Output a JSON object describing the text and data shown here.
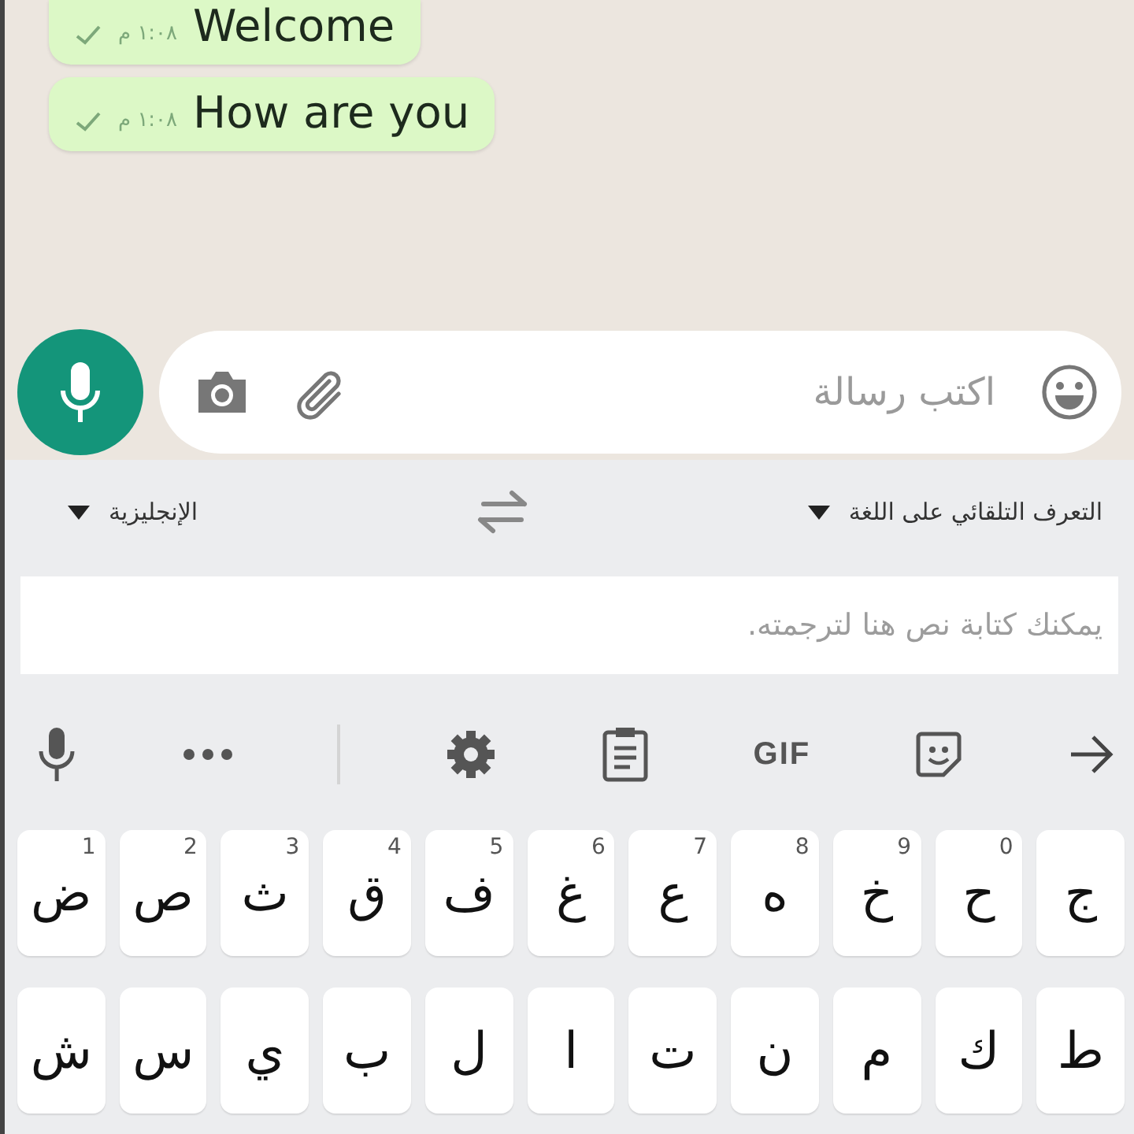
{
  "messages": [
    {
      "text": "Welcome",
      "time": "١:٠٨ م",
      "delivered": true
    },
    {
      "text": "How are you",
      "time": "١:٠٨ م",
      "delivered": true
    }
  ],
  "composer": {
    "placeholder": "اكتب رسالة"
  },
  "translator": {
    "source_language": "التعرف التلقائي على اللغة",
    "target_language": "الإنجليزية",
    "placeholder": "يمكنك كتابة نص هنا لترجمته."
  },
  "toolbar": {
    "gif_label": "GIF"
  },
  "keyboard": {
    "rows": [
      [
        {
          "char": "ج"
        },
        {
          "char": "ح",
          "hint": "0"
        },
        {
          "char": "خ",
          "hint": "9"
        },
        {
          "char": "ه",
          "hint": "8"
        },
        {
          "char": "ع",
          "hint": "7"
        },
        {
          "char": "غ",
          "hint": "6"
        },
        {
          "char": "ف",
          "hint": "5"
        },
        {
          "char": "ق",
          "hint": "4"
        },
        {
          "char": "ث",
          "hint": "3"
        },
        {
          "char": "ص",
          "hint": "2"
        },
        {
          "char": "ض",
          "hint": "1"
        }
      ],
      [
        {
          "char": "ط"
        },
        {
          "char": "ك"
        },
        {
          "char": "م"
        },
        {
          "char": "ن"
        },
        {
          "char": "ت"
        },
        {
          "char": "ا"
        },
        {
          "char": "ل"
        },
        {
          "char": "ب"
        },
        {
          "char": "ي"
        },
        {
          "char": "س"
        },
        {
          "char": "ش"
        }
      ]
    ]
  }
}
